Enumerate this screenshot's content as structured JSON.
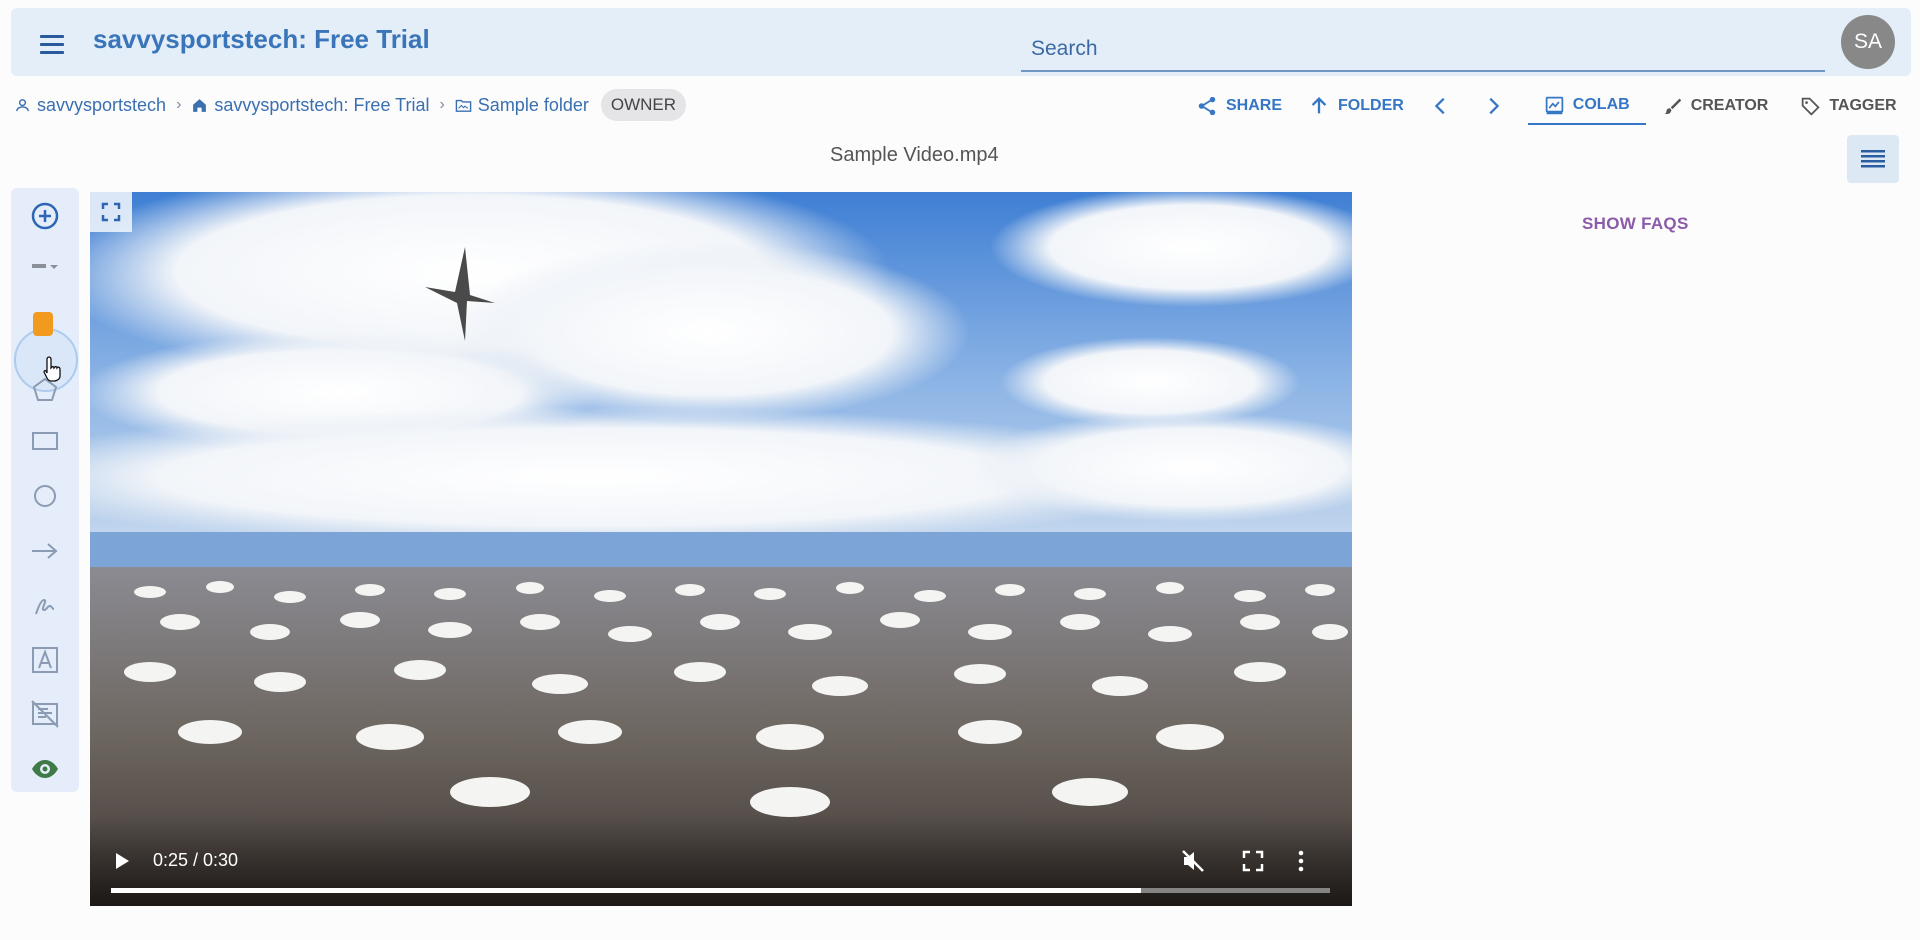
{
  "header": {
    "title": "savvysportstech: Free Trial",
    "search_placeholder": "Search",
    "avatar_initials": "SA"
  },
  "breadcrumb": {
    "items": [
      "savvysportstech",
      "savvysportstech: Free Trial",
      "Sample folder"
    ],
    "role_badge": "OWNER"
  },
  "actions": {
    "share": "SHARE",
    "folder": "FOLDER"
  },
  "tabs": [
    {
      "label": "COLAB",
      "icon": "colab-icon",
      "active": true
    },
    {
      "label": "CREATOR",
      "icon": "brush-icon",
      "active": false
    },
    {
      "label": "TAGGER",
      "icon": "tag-icon",
      "active": false
    }
  ],
  "file_name": "Sample Video.mp4",
  "toolbar": {
    "tools": [
      "add-icon",
      "line-style-icon",
      "color-swatch-icon",
      "polygon-icon",
      "rectangle-icon",
      "circle-icon",
      "arrow-icon",
      "freehand-icon",
      "text-icon",
      "clear-annotations-icon",
      "visibility-icon"
    ],
    "active_color": "#f29a1e"
  },
  "video": {
    "time": "0:25 / 0:30",
    "progress": 0.845
  },
  "faq_label": "SHOW FAQS",
  "colors": {
    "accent": "#3576c5",
    "faq": "#8b5aa8",
    "header_bg": "#e3eef9"
  }
}
